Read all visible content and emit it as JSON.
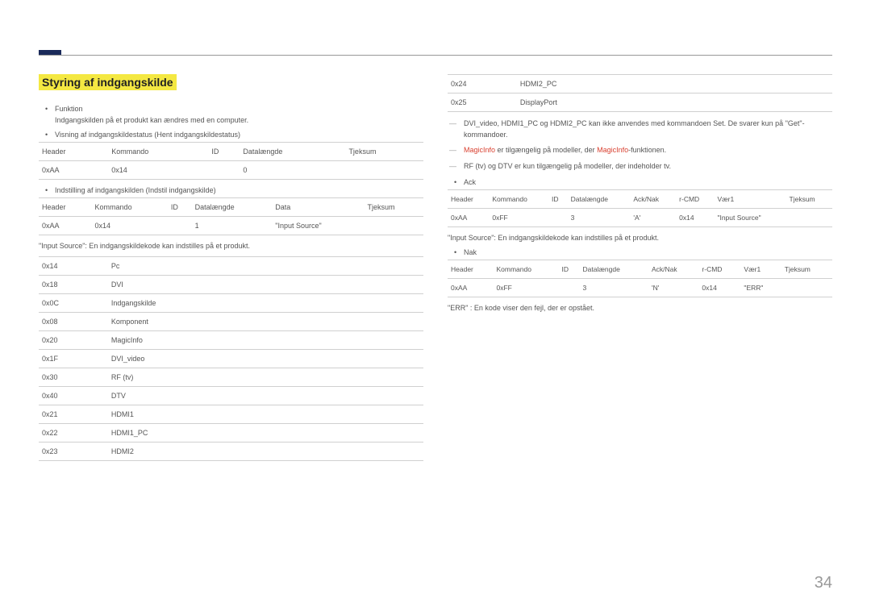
{
  "heading": "Styring af indgangskilde",
  "left": {
    "funktion_label": "Funktion",
    "funktion_desc": "Indgangskilden på et produkt kan ændres med en computer.",
    "visning_label": "Visning af indgangskildestatus (Hent indgangskildestatus)",
    "t1": {
      "h": [
        "Header",
        "Kommando",
        "ID",
        "Datalængde",
        "Tjeksum"
      ],
      "r": [
        "0xAA",
        "0x14",
        "",
        "0",
        ""
      ]
    },
    "indstilling_label": "Indstilling af indgangskilden (Indstil indgangskilde)",
    "t2": {
      "h": [
        "Header",
        "Kommando",
        "ID",
        "Datalængde",
        "Data",
        "Tjeksum"
      ],
      "r": [
        "0xAA",
        "0x14",
        "",
        "1",
        "\"Input Source\"",
        ""
      ]
    },
    "desc1": "\"Input Source\": En indgangskildekode kan indstilles på et produkt.",
    "codes": [
      [
        "0x14",
        "Pc"
      ],
      [
        "0x18",
        "DVI"
      ],
      [
        "0x0C",
        "Indgangskilde"
      ],
      [
        "0x08",
        "Komponent"
      ],
      [
        "0x20",
        "MagicInfo"
      ],
      [
        "0x1F",
        "DVI_video"
      ],
      [
        "0x30",
        "RF (tv)"
      ],
      [
        "0x40",
        "DTV"
      ],
      [
        "0x21",
        "HDMI1"
      ],
      [
        "0x22",
        "HDMI1_PC"
      ],
      [
        "0x23",
        "HDMI2"
      ]
    ]
  },
  "right": {
    "codes": [
      [
        "0x24",
        "HDMI2_PC"
      ],
      [
        "0x25",
        "DisplayPort"
      ]
    ],
    "note1": "DVI_video, HDMI1_PC og HDMI2_PC kan ikke anvendes med kommandoen Set. De svarer kun på \"Get\"-kommandoer.",
    "note2_a": "MagicInfo",
    "note2_b": " er tilgængelig på modeller, der ",
    "note2_c": "MagicInfo",
    "note2_d": "-funktionen.",
    "note3": "RF (tv) og DTV er kun tilgængelig på modeller, der indeholder tv.",
    "ack_label": "Ack",
    "t3": {
      "h": [
        "Header",
        "Kommando",
        "ID",
        "Datalængde",
        "Ack/Nak",
        "r-CMD",
        "Vær1",
        "Tjeksum"
      ],
      "r": [
        "0xAA",
        "0xFF",
        "",
        "3",
        "'A'",
        "0x14",
        "\"Input Source\"",
        ""
      ]
    },
    "desc2": "\"Input Source\": En indgangskildekode kan indstilles på et produkt.",
    "nak_label": "Nak",
    "t4": {
      "h": [
        "Header",
        "Kommando",
        "ID",
        "Datalængde",
        "Ack/Nak",
        "r-CMD",
        "Vær1",
        "Tjeksum"
      ],
      "r": [
        "0xAA",
        "0xFF",
        "",
        "3",
        "'N'",
        "0x14",
        "\"ERR\"",
        ""
      ]
    },
    "err_desc": "\"ERR\" : En kode viser den fejl, der er opstået."
  },
  "page_number": "34"
}
